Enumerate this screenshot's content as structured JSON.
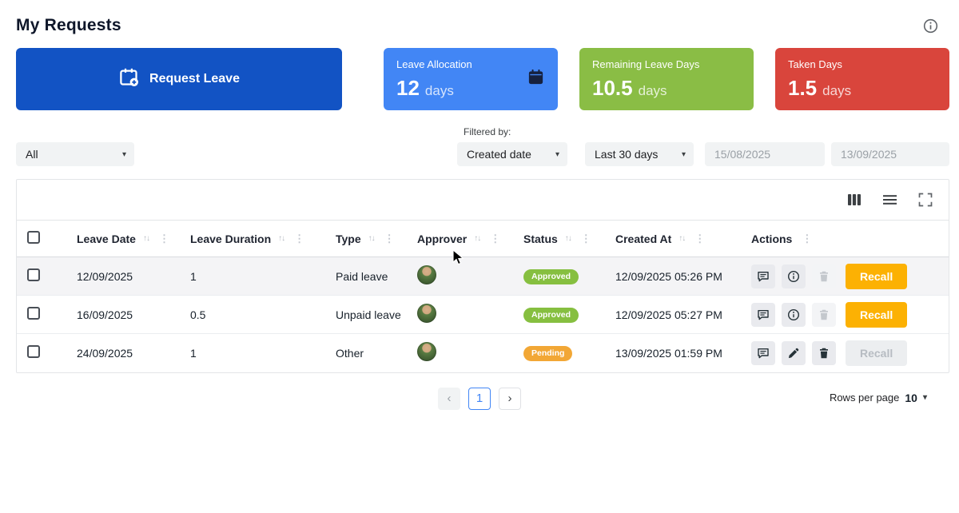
{
  "page": {
    "title": "My Requests"
  },
  "cards": {
    "request_leave": {
      "label": "Request Leave"
    },
    "stats": [
      {
        "label": "Leave Allocation",
        "value": "12",
        "unit": "days"
      },
      {
        "label": "Remaining Leave Days",
        "value": "10.5",
        "unit": "days"
      },
      {
        "label": "Taken Days",
        "value": "1.5",
        "unit": "days"
      }
    ]
  },
  "filters": {
    "status_filter": {
      "value": "All"
    },
    "filtered_by_label": "Filtered by:",
    "field_filter": {
      "value": "Created date"
    },
    "range_filter": {
      "value": "Last 30 days"
    },
    "date_from": {
      "value": "15/08/2025"
    },
    "date_to": {
      "value": "13/09/2025"
    }
  },
  "table": {
    "columns": [
      {
        "label": "Leave Date"
      },
      {
        "label": "Leave Duration"
      },
      {
        "label": "Type"
      },
      {
        "label": "Approver"
      },
      {
        "label": "Status"
      },
      {
        "label": "Created At"
      },
      {
        "label": "Actions"
      }
    ],
    "rows": [
      {
        "leave_date": "12/09/2025",
        "leave_duration": "1",
        "type": "Paid leave",
        "status": "Approved",
        "created_at": "12/09/2025 05:26 PM",
        "recall_label": "Recall"
      },
      {
        "leave_date": "16/09/2025",
        "leave_duration": "0.5",
        "type": "Unpaid leave",
        "status": "Approved",
        "created_at": "12/09/2025 05:27 PM",
        "recall_label": "Recall"
      },
      {
        "leave_date": "24/09/2025",
        "leave_duration": "1",
        "type": "Other",
        "status": "Pending",
        "created_at": "13/09/2025 01:59 PM",
        "recall_label": "Recall"
      }
    ]
  },
  "pagination": {
    "prev": "‹",
    "current_page": "1",
    "next": "›",
    "rows_per_page_label": "Rows per page",
    "rows_per_page_value": "10"
  },
  "icons": {
    "sort_glyph": "↑↓",
    "kebab_glyph": "⋮",
    "chevron_down": "▾"
  },
  "colors": {
    "primary_button": "#1253c4",
    "allocation_card": "#4286f5",
    "remaining_card": "#8abd45",
    "taken_card": "#d9453c",
    "recall_button": "#fcb103",
    "approved_badge": "#86bf40",
    "pending_badge": "#f2a735"
  }
}
